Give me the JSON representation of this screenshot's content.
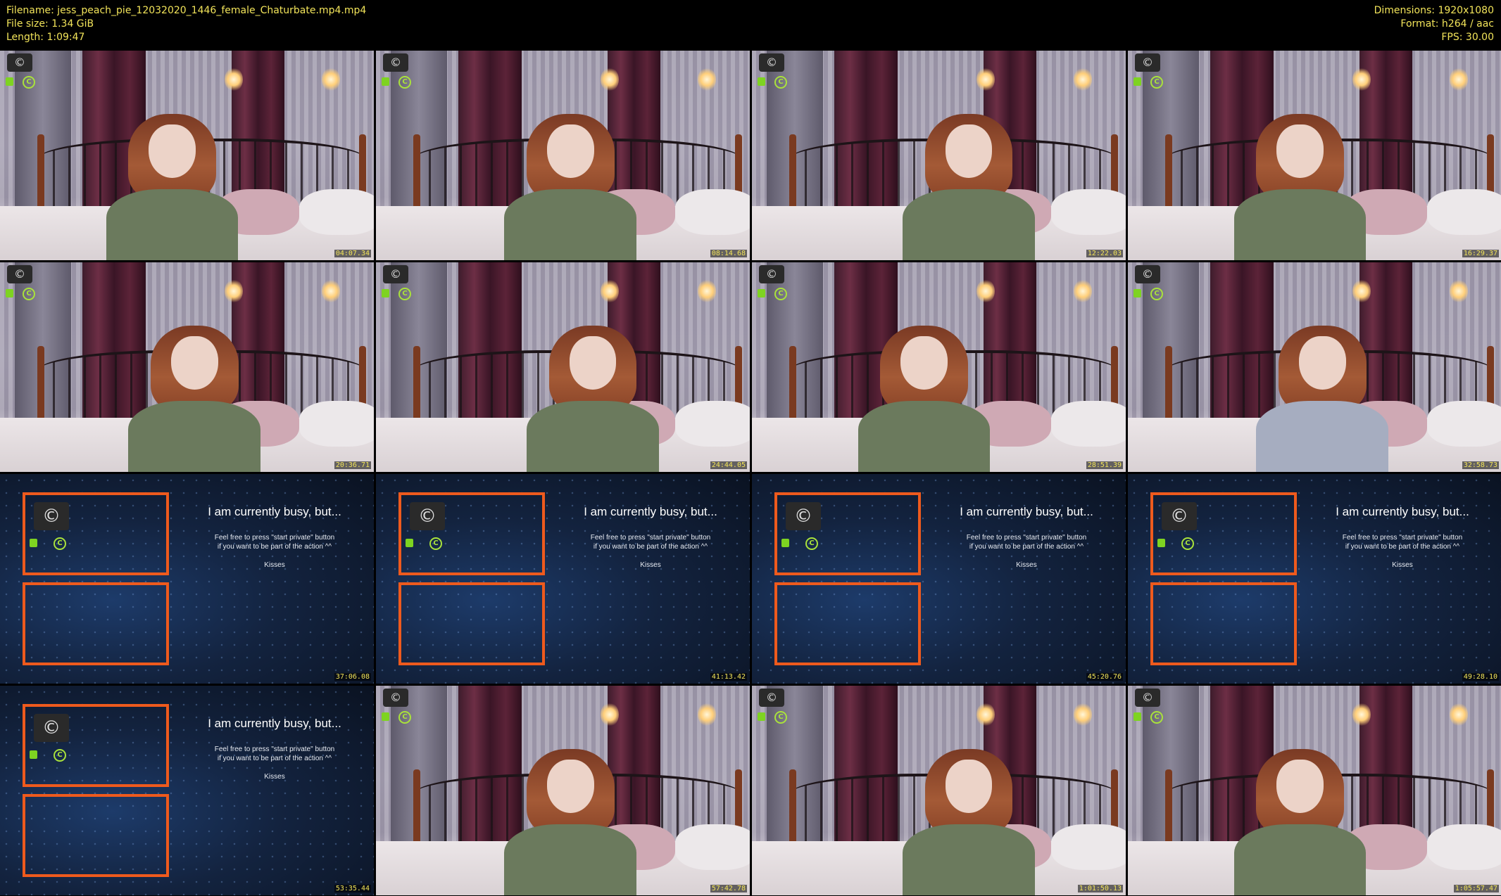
{
  "header": {
    "filename": "Filename: jess_peach_pie_12032020_1446_female_Chaturbate.mp4.mp4",
    "filesize": "File size: 1.34 GiB",
    "length": "Length: 1:09:47",
    "dimensions": "Dimensions: 1920x1080",
    "format": "Format: h264 / aac",
    "fps": "FPS: 30.00"
  },
  "busy_screen": {
    "title": "I am currently busy, but...",
    "line1": "Feel free to press \"start private\" button",
    "line2": "if you want to be part of the action ^^",
    "kisses": "Kisses"
  },
  "thumbnails": [
    {
      "timestamp": "04:07.34",
      "kind": "cam",
      "shirt": "green"
    },
    {
      "timestamp": "08:14.68",
      "kind": "cam",
      "shirt": "green"
    },
    {
      "timestamp": "12:22.03",
      "kind": "cam",
      "shirt": "green"
    },
    {
      "timestamp": "16:29.37",
      "kind": "cam",
      "shirt": "green"
    },
    {
      "timestamp": "20:36.71",
      "kind": "cam",
      "shirt": "green"
    },
    {
      "timestamp": "24:44.05",
      "kind": "cam",
      "shirt": "green"
    },
    {
      "timestamp": "28:51.39",
      "kind": "cam",
      "shirt": "green"
    },
    {
      "timestamp": "32:58.73",
      "kind": "cam",
      "shirt": "grey"
    },
    {
      "timestamp": "37:06.08",
      "kind": "busy"
    },
    {
      "timestamp": "41:13.42",
      "kind": "busy"
    },
    {
      "timestamp": "45:20.76",
      "kind": "busy"
    },
    {
      "timestamp": "49:28.10",
      "kind": "busy"
    },
    {
      "timestamp": "53:35.44",
      "kind": "busy"
    },
    {
      "timestamp": "57:42.78",
      "kind": "cam",
      "shirt": "green"
    },
    {
      "timestamp": "1:01:50.13",
      "kind": "cam",
      "shirt": "green"
    },
    {
      "timestamp": "1:05:57.47",
      "kind": "cam",
      "shirt": "green"
    }
  ]
}
